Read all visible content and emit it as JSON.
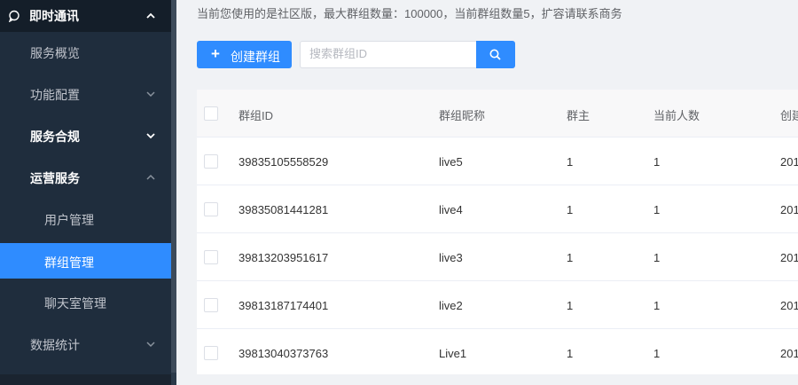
{
  "sidebar": {
    "top": {
      "label": "即时通讯"
    },
    "items": [
      {
        "label": "服务概览"
      },
      {
        "label": "功能配置"
      },
      {
        "label": "服务合规"
      },
      {
        "label": "运营服务"
      },
      {
        "label": "用户管理"
      },
      {
        "label": "群组管理"
      },
      {
        "label": "聊天室管理"
      },
      {
        "label": "数据统计"
      }
    ]
  },
  "notice": "当前您使用的是社区版，最大群组数量：100000，当前群组数量5，扩容请联系商务",
  "toolbar": {
    "create_plus": "+",
    "create_label": "创建群组",
    "search_placeholder": "搜索群组ID"
  },
  "table": {
    "headers": [
      "群组ID",
      "群组昵称",
      "群主",
      "当前人数",
      "创建时间"
    ],
    "rows": [
      {
        "id": "39835105558529",
        "nick": "live5",
        "owner": "1",
        "count": "1",
        "created": "201"
      },
      {
        "id": "39835081441281",
        "nick": "live4",
        "owner": "1",
        "count": "1",
        "created": "201"
      },
      {
        "id": "39813203951617",
        "nick": "live3",
        "owner": "1",
        "count": "1",
        "created": "201"
      },
      {
        "id": "39813187174401",
        "nick": "live2",
        "owner": "1",
        "count": "1",
        "created": "201"
      },
      {
        "id": "39813040373763",
        "nick": "Live1",
        "owner": "1",
        "count": "1",
        "created": "201"
      }
    ]
  },
  "colors": {
    "accent": "#2f8cff",
    "sidebar_bg": "#1f2d3d"
  }
}
